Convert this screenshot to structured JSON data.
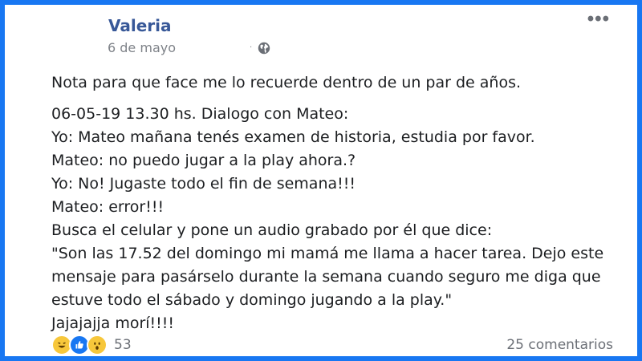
{
  "post": {
    "author": "Valeria",
    "date": "6 de mayo",
    "separator": "·",
    "privacy_icon": "globe-icon",
    "more_icon": "more-options-icon",
    "lines": [
      "Nota para que face me lo recuerde dentro de un par de años.",
      "06-05-19 13.30 hs. Dialogo con Mateo:",
      "Yo: Mateo mañana tenés examen de historia, estudia por favor.",
      "Mateo: no puedo jugar a la play ahora.?",
      "Yo: No! Jugaste todo el fin de semana!!!",
      "Mateo: error!!!",
      "Busca el celular y pone un audio grabado por él que dice:",
      "\"Son las 17.52 del domingo mi mamá me llama a hacer tarea. Dejo este",
      "mensaje para pasárselo durante la semana cuando seguro me diga que",
      "estuve todo el sábado y domingo jugando a la play.\"",
      "Jajajajja morí!!!!"
    ]
  },
  "footer": {
    "reaction_icons": [
      "haha-icon",
      "like-icon",
      "wow-icon"
    ],
    "reactions_count": "53",
    "comments": "25 comentarios"
  },
  "colors": {
    "frame": "#1877f2",
    "author": "#385898",
    "text": "#1c1e21",
    "muted": "#6b6f76"
  }
}
